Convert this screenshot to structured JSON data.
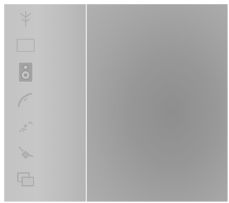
{
  "sidebar": {
    "items": [
      {
        "icon": "antenna-icon"
      },
      {
        "icon": "display-icon"
      },
      {
        "icon": "speaker-icon"
      },
      {
        "icon": "dish-icon"
      },
      {
        "icon": "signal-icon"
      },
      {
        "icon": "plug-icon"
      },
      {
        "icon": "windows-icon"
      }
    ]
  },
  "colors": {
    "sidebar_bg": "#c4c4c4",
    "main_bg": "#9a9a9a",
    "divider": "#e3e3e3",
    "icon_fill": "#a9a9a9"
  }
}
